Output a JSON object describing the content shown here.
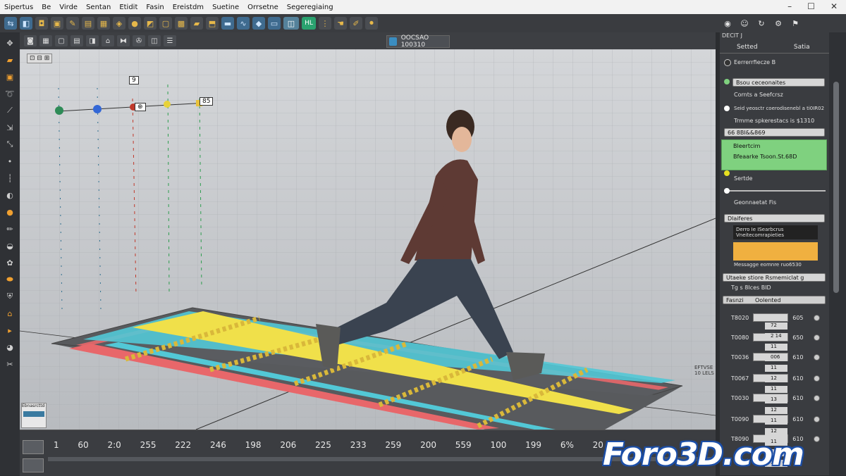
{
  "menu": [
    "Sipertus",
    "Be",
    "Virde",
    "Sentan",
    "Etidit",
    "Fasin",
    "Ereistdm",
    "Suetine",
    "Orrsetne",
    "Segeregiaing"
  ],
  "view_label": "OOCSAO 100310",
  "viewport_badge": "⊡ ⊟ ⊞",
  "marker_labels": [
    "9",
    "⊕",
    "85"
  ],
  "timeline_numbers": [
    "1",
    "60",
    "2:0",
    "255",
    "222",
    "246",
    "198",
    "206",
    "225",
    "233",
    "259",
    "200",
    "559",
    "100",
    "199",
    "6%",
    "20"
  ],
  "panel": {
    "header": "DECIT J",
    "tabs": [
      "Setted",
      "Satia"
    ],
    "rows": [
      "Eerrerrfiecze B",
      "Bsou ceceonaites",
      "Cornts a Seefcrsz",
      "Seid yeosctr coerodisenebl a ti0IR02",
      "Trmme spkerestacs is $1310",
      "66 8BI&&869",
      "Bleertcim",
      "Bfeaarke Tsoon.St.68D",
      "Sertde",
      "Geonnaetat Fis",
      "Dlaiferes",
      "Derro Ie ISearbcrus",
      "Vneitecomrapieties",
      "Messagge eomnre ruo6530",
      "Utaeke stiore Rsmemiclat g",
      "Tg s 8Ices BID",
      "Fasnzi",
      "Oolented"
    ],
    "param_labels": [
      "T8020",
      "T0080",
      "T0036",
      "T0067",
      "T0030",
      "T0090",
      "T8090"
    ],
    "param_values": [
      "605",
      "650",
      "610",
      "610",
      "610",
      "610",
      "610"
    ],
    "param_sub": [
      "72",
      "2  14",
      "11",
      "006",
      "11",
      "12",
      "11",
      "13",
      "12",
      "11",
      "12",
      "11",
      "11",
      "12"
    ],
    "side_note": "EFTVSE\n10 LELS"
  },
  "watermark": "Foro3D.com",
  "bottom_left_label": "Ebnasrcttd",
  "colors": {
    "accent_green": "#7fd17f",
    "accent_orange": "#f0b040",
    "selected_tool": "#55829b",
    "track_red": "#e8676a",
    "track_teal": "#52c8d6",
    "track_yellow": "#f0e04a"
  }
}
